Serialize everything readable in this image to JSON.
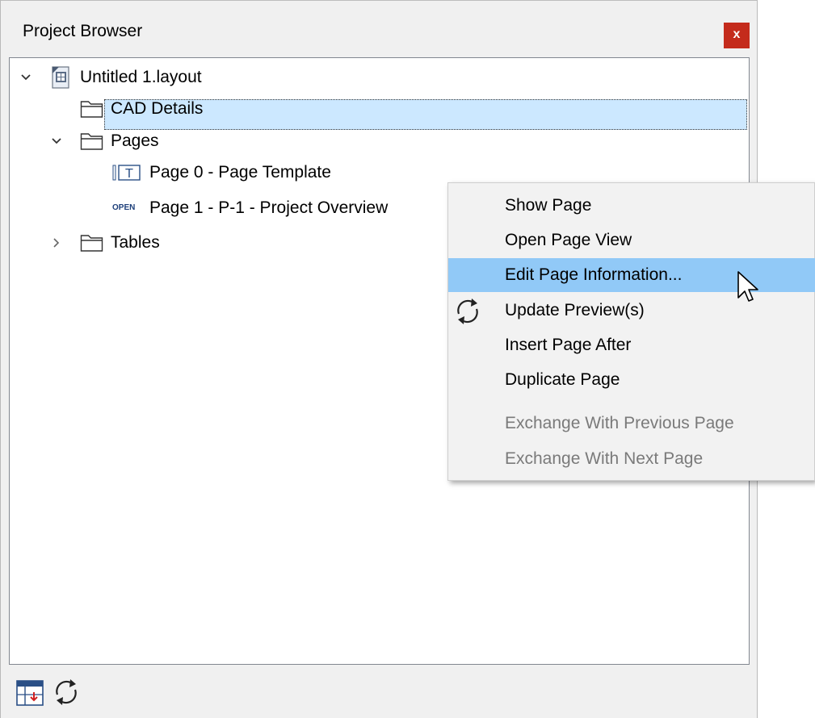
{
  "window": {
    "title": "Project Browser",
    "close_label": "x"
  },
  "tree": {
    "root": {
      "label": "Untitled 1.layout",
      "icon": "layout-file-icon",
      "expanded": true
    },
    "items": [
      {
        "label": "CAD Details",
        "icon": "folder-icon"
      },
      {
        "label": "Pages",
        "icon": "folder-icon",
        "expanded": true
      },
      {
        "label": "Page 0 - Page Template",
        "icon": "page-template-icon",
        "selected": true
      },
      {
        "label": "Page 1 - P-1 - Project Overview",
        "icon": "open-page-icon",
        "badge": "OPEN"
      },
      {
        "label": "Tables",
        "icon": "folder-icon",
        "expanded": false
      }
    ]
  },
  "context_menu": {
    "items": [
      {
        "label": "Show Page",
        "enabled": true
      },
      {
        "label": "Open Page View",
        "enabled": true
      },
      {
        "label": "Edit Page Information...",
        "enabled": true,
        "hovered": true
      },
      {
        "label": "Update Preview(s)",
        "enabled": true,
        "icon": "refresh-icon"
      },
      {
        "label": "Insert Page After",
        "enabled": true
      },
      {
        "label": "Duplicate Page",
        "enabled": true
      },
      {
        "label": "Exchange With Previous Page",
        "enabled": false
      },
      {
        "label": "Exchange With Next Page",
        "enabled": false
      }
    ]
  },
  "bottom_toolbar": {
    "buttons": [
      "table-insert-icon",
      "refresh-icon"
    ]
  },
  "colors": {
    "selection": "#cce8ff",
    "menu_hover": "#91c9f7",
    "close_button": "#c42b1c"
  }
}
